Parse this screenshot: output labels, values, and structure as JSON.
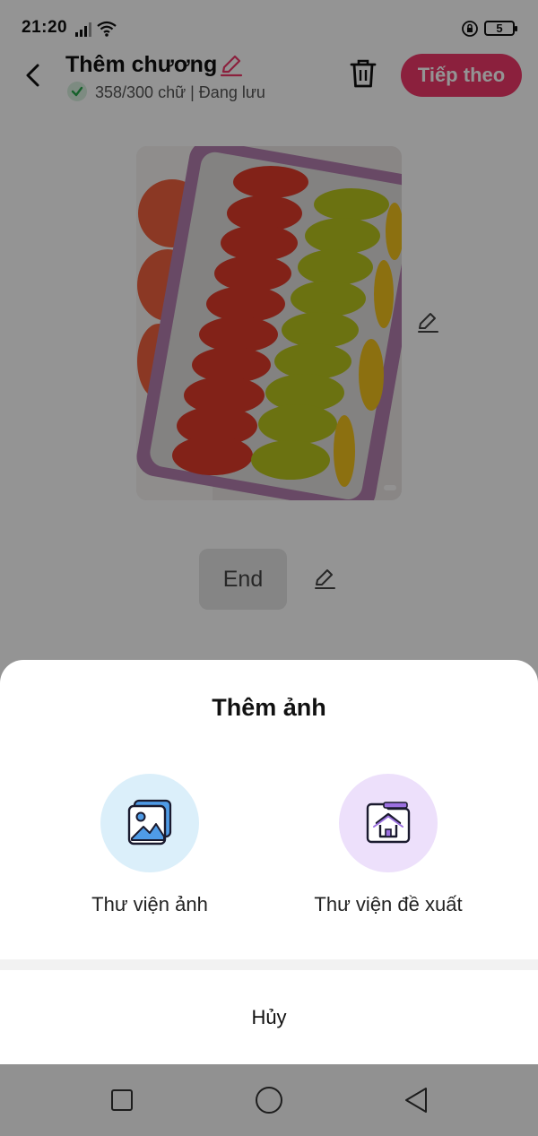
{
  "status_bar": {
    "time": "21:20",
    "battery_level": "5",
    "icons": [
      "signal-icon",
      "wifi-icon",
      "rotation-lock-icon",
      "battery-icon"
    ]
  },
  "header": {
    "title": "Thêm chương",
    "subtitle": "358/300 chữ | Đang lưu",
    "next_label": "Tiếp theo",
    "accent_color": "#f0386a"
  },
  "content": {
    "end_label": "End"
  },
  "sheet": {
    "title": "Thêm ảnh",
    "options": [
      {
        "label": "Thư viện ảnh",
        "icon": "image-gallery-icon",
        "circle_color": "#dbeffa"
      },
      {
        "label": "Thư viện đề xuất",
        "icon": "suggested-library-icon",
        "circle_color": "#ede0fb"
      }
    ],
    "cancel_label": "Hủy"
  },
  "nav_bar": {
    "icons": [
      "recent-apps-icon",
      "home-icon",
      "back-nav-icon"
    ]
  }
}
